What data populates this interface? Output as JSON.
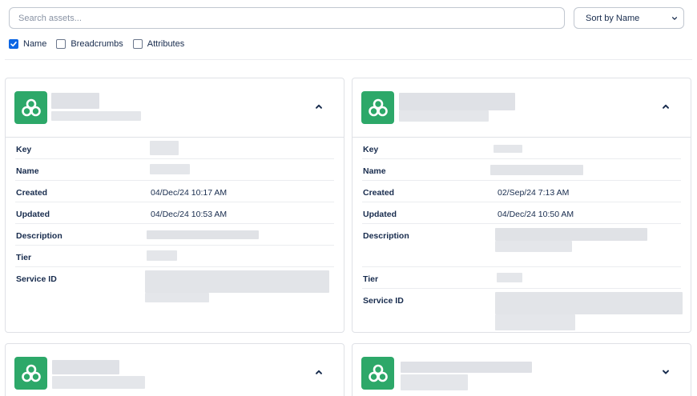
{
  "search": {
    "placeholder": "Search assets..."
  },
  "sort": {
    "label": "Sort by Name"
  },
  "filters": [
    {
      "label": "Name",
      "checked": true
    },
    {
      "label": "Breadcrumbs",
      "checked": false
    },
    {
      "label": "Attributes",
      "checked": false
    }
  ],
  "fields": {
    "key": "Key",
    "name": "Name",
    "created": "Created",
    "updated": "Updated",
    "description": "Description",
    "tier": "Tier",
    "service_id": "Service ID"
  },
  "cards": [
    {
      "created": "04/Dec/24 10:17 AM",
      "updated": "04/Dec/24 10:53 AM",
      "expanded": true
    },
    {
      "created": "02/Sep/24 7:13 AM",
      "updated": "04/Dec/24 10:50 AM",
      "expanded": true
    },
    {
      "expanded": true
    },
    {
      "expanded": false
    }
  ],
  "colors": {
    "accent": "#0c66e4",
    "logo": "#2da869",
    "redacted": "#dfe1e6"
  },
  "icons": {
    "logo": "three-rings-icon",
    "collapse": "chevron-up-icon",
    "expand": "chevron-down-icon",
    "sort": "chevron-down-icon",
    "check": "check-icon"
  }
}
